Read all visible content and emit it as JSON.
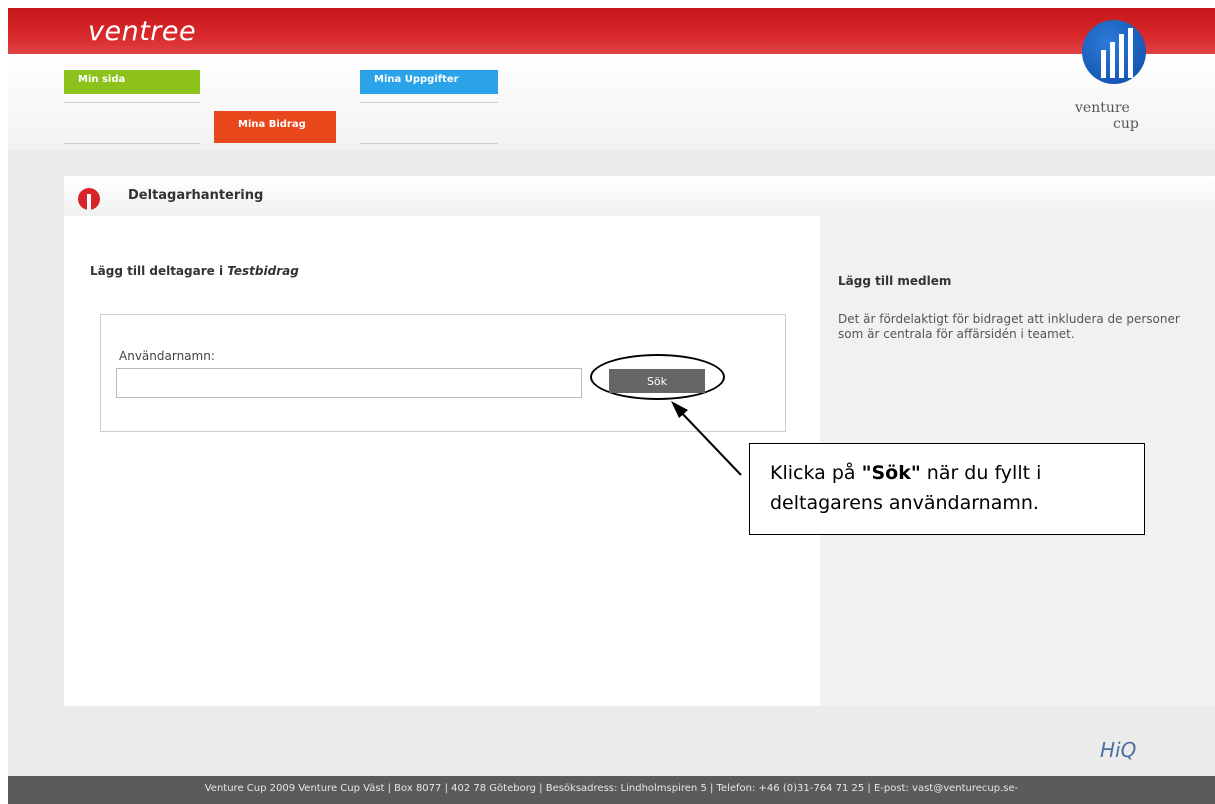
{
  "app": {
    "logo": "ventree",
    "brand_top": "venture",
    "brand_bottom": "cup"
  },
  "nav": {
    "tab_min_sida": "Min sida",
    "tab_mina_uppgifter": "Mina Uppgifter",
    "tab_mina_bidrag": "Mina Bidrag"
  },
  "panel": {
    "title": "Deltagarhantering"
  },
  "form": {
    "heading_prefix": "Lägg till deltagare i ",
    "heading_project": "Testbidrag",
    "username_label": "Användarnamn:",
    "username_value": "",
    "search_button": "Sök"
  },
  "sidebar": {
    "title": "Lägg till medlem",
    "text": "Det är fördelaktigt för bidraget att inkludera de personer som är centrala för affärsidén i teamet."
  },
  "callout": {
    "prefix": "Klicka på ",
    "bold": "\"Sök\"",
    "suffix": " när du fyllt i deltagarens användarnamn."
  },
  "footer": {
    "text": "Venture Cup 2009 Venture Cup Väst | Box 8077 | 402 78 Göteborg | Besöksadress: Lindholmspiren 5 | Telefon: +46 (0)31-764 71 25 | E-post: vast@venturecup.se-"
  },
  "colors": {
    "header_red": "#d8282b",
    "tab_green": "#8cc21b",
    "tab_blue": "#2aa3e8",
    "tab_orange": "#e8461b",
    "button_gray": "#666666",
    "footer_gray": "#5b5b5b"
  }
}
